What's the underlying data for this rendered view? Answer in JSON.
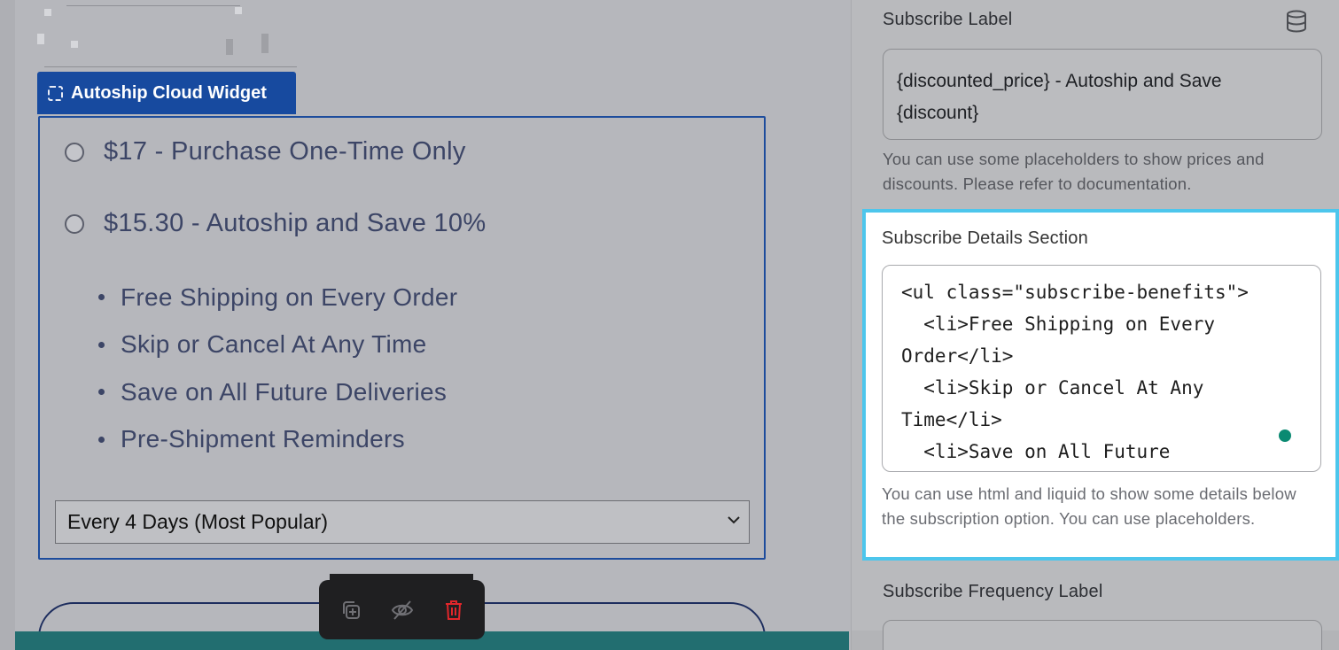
{
  "widget": {
    "tag_label": "Autoship Cloud Widget",
    "tag_icon": "selection-dashed-icon",
    "options": [
      {
        "label": "$17 - Purchase One-Time Only"
      },
      {
        "label": "$15.30 - Autoship and Save 10%"
      }
    ],
    "benefits": [
      "Free Shipping on Every Order",
      "Skip or Cancel At Any Time",
      "Save on All Future Deliveries",
      "Pre-Shipment Reminders"
    ],
    "frequency_value": "Every 4 Days (Most Popular)"
  },
  "toolbar": {
    "icons": [
      "duplicate-icon",
      "hide-icon",
      "delete-icon"
    ]
  },
  "settings": {
    "subscribe_label": {
      "label": "Subscribe Label",
      "value": "{discounted_price} - Autoship and Save {discount}",
      "help": "You can use some placeholders to show prices and discounts. Please refer to documentation."
    },
    "details_section": {
      "label": "Subscribe Details Section",
      "code": "<ul class=\"subscribe-benefits\">\n  <li>Free Shipping on Every\nOrder</li>\n  <li>Skip or Cancel At Any\nTime</li>\n  <li>Save on All Future",
      "help": "You can use html and liquid to show some details below the subscription option. You can use placeholders."
    },
    "frequency_label": {
      "label": "Subscribe Frequency Label"
    }
  },
  "colors": {
    "accent_blue": "#174a9f",
    "highlight_border": "#4dc6ec",
    "status_dot": "#0b8a72",
    "delete_red": "#e0262b",
    "footer_teal": "#226e70"
  }
}
